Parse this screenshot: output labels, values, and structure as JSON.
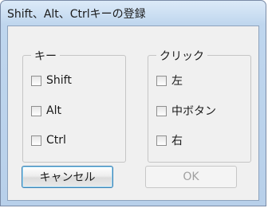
{
  "window": {
    "title": "Shift、Alt、Ctrlキーの登録"
  },
  "keys_group": {
    "label": "キー",
    "items": [
      {
        "label": "Shift",
        "checked": false
      },
      {
        "label": "Alt",
        "checked": false
      },
      {
        "label": "Ctrl",
        "checked": false
      }
    ]
  },
  "click_group": {
    "label": "クリック",
    "items": [
      {
        "label": "左",
        "checked": false
      },
      {
        "label": "中ボタン",
        "checked": false
      },
      {
        "label": "右",
        "checked": false
      }
    ]
  },
  "buttons": {
    "cancel_label": "キャンセル",
    "ok_label": "OK",
    "ok_enabled": false
  },
  "colors": {
    "title_bar": "#bfd6ee",
    "focus_border": "#3c7fb1",
    "dialog_bg": "#f0f0f0"
  }
}
